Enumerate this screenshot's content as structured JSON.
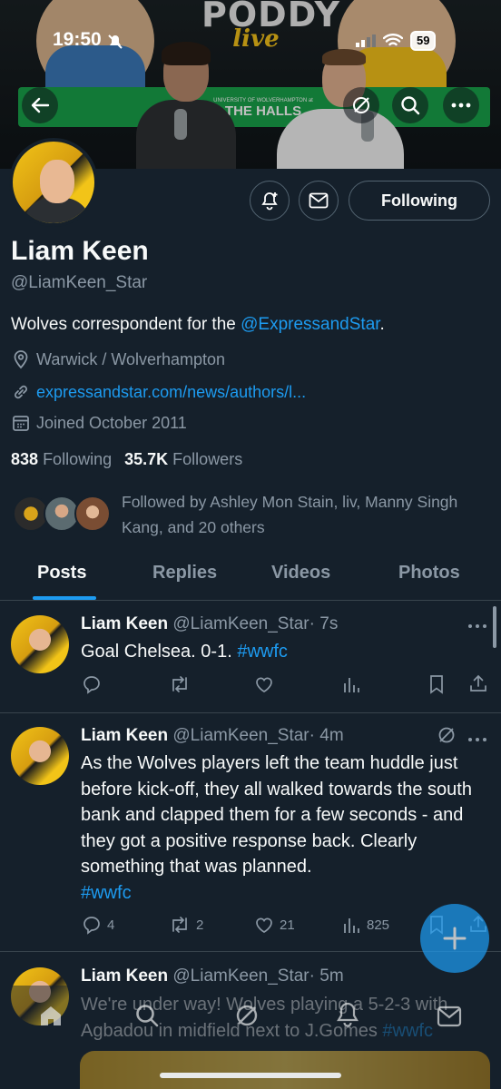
{
  "status_bar": {
    "time": "19:50",
    "battery": "59"
  },
  "banner": {
    "logo": "PODDY",
    "logo_sub": "live",
    "venue": "THE HALLS",
    "venue_small": "UNIVERSITY OF WOLVERHAMPTON at"
  },
  "profile": {
    "name": "Liam Keen",
    "handle": "@LiamKeen_Star",
    "bio_prefix": "Wolves correspondent for the ",
    "bio_mention": "@ExpressandStar",
    "bio_suffix": ".",
    "location": "Warwick / Wolverhampton",
    "website": "expressandstar.com/news/authors/l...",
    "joined": "Joined October 2011",
    "following_count": "838",
    "following_label": "Following",
    "followers_count": "35.7K",
    "followers_label": "Followers",
    "followed_by": "Followed by Ashley Mon Stain, liv, Manny Singh Kang, and 20 others",
    "following_button": "Following"
  },
  "tabs": [
    "Posts",
    "Replies",
    "Videos",
    "Photos"
  ],
  "posts": [
    {
      "name": "Liam Keen",
      "handle": "@LiamKeen_Star",
      "time": "· 7s",
      "text": "Goal Chelsea. 0-1. ",
      "hashtag": "#wwfc"
    },
    {
      "name": "Liam Keen",
      "handle": "@LiamKeen_Star",
      "time": "· 4m",
      "text": "As the Wolves players left the team huddle just before kick-off, they all walked towards the south bank and clapped them for a few seconds - and they got a positive response back. Clearly something that was planned.",
      "hashtag": "#wwfc",
      "replies": "4",
      "reposts": "2",
      "likes": "21",
      "views": "825"
    },
    {
      "name": "Liam Keen",
      "handle": "@LiamKeen_Star",
      "time": "· 5m",
      "text": "We're under way! Wolves playing a 5-2-3 with Agbadou in midfield next to J.Gomes ",
      "hashtag": "#wwfc"
    }
  ],
  "colors": {
    "background": "#15202b",
    "accent": "#1d9bf0",
    "muted": "#8b98a5",
    "border": "#38444d"
  }
}
